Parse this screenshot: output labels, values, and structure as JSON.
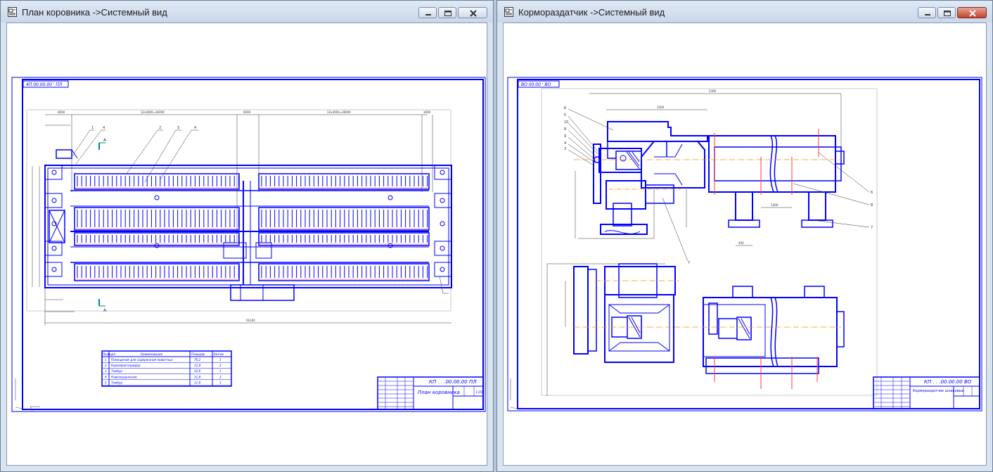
{
  "windows": {
    "left": {
      "title": "План коровника ->Системный вид",
      "sheet_code": "КП . . .00.00.00 ПЛ",
      "sheet_title": "План коровника",
      "top_stamp": "4П 00.00.00 ' ПЛ",
      "section_mark": "А",
      "bom": {
        "headers": [
          "Позиция",
          "Наименование",
          "Площадь",
          "Кол-во"
        ],
        "rows": [
          [
            "1",
            "Помещение для содержания животных",
            "76,2",
            "1"
          ],
          [
            "2",
            "Кормовой коридор",
            "11,8",
            "2"
          ],
          [
            "3",
            "Тамбур",
            "12,6",
            "1"
          ],
          [
            "4",
            "Навозоудаление",
            "11,8",
            "2"
          ],
          [
            "5",
            "Тамбур",
            "11,6",
            "1"
          ]
        ]
      }
    },
    "right": {
      "title": "Кормораздатчик ->Системный вид",
      "sheet_code": "КП . . .00.00.00 ВО",
      "sheet_title": "Кормораздатчик шнековый",
      "top_stamp": "ВО 00.00 ' ВО"
    }
  },
  "colors": {
    "drawing_blue": "#0000ff",
    "axis_orange": "#ff8c00",
    "title_bg": "#cfdcec"
  }
}
